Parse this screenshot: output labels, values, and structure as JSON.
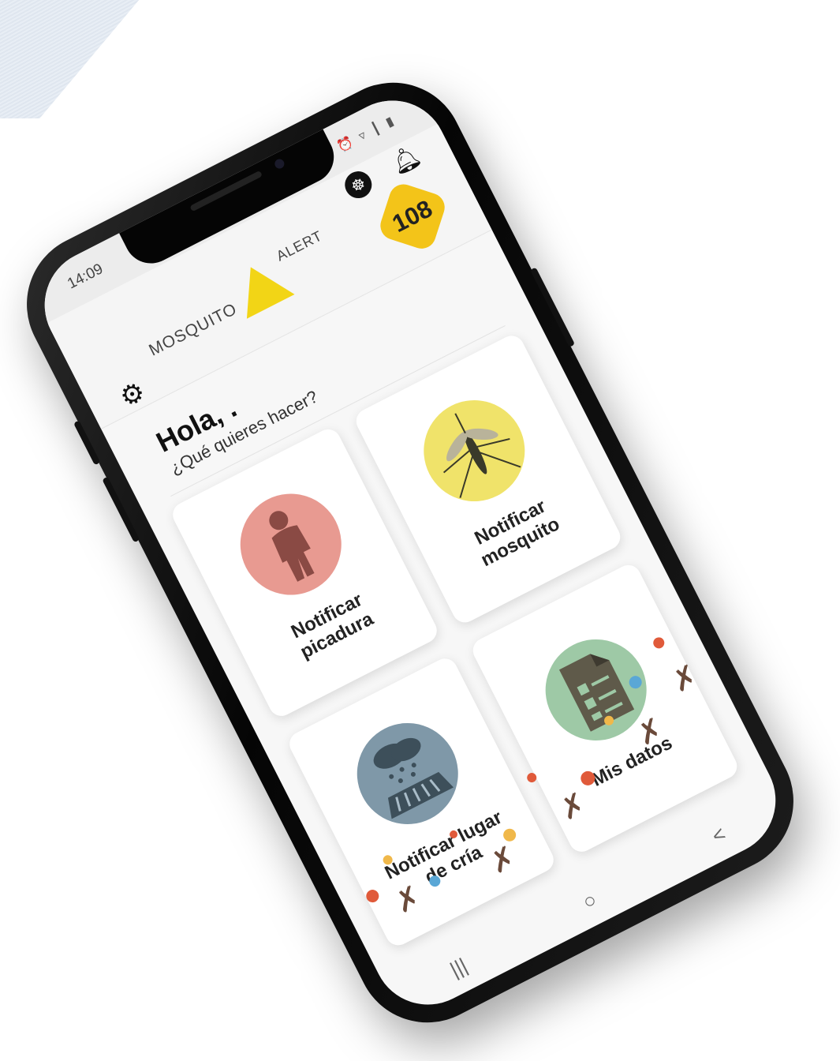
{
  "status_bar": {
    "time": "14:09",
    "icons": "⏰ ▿ ┃ ▮"
  },
  "header": {
    "logo_left": "MOSQUITO",
    "logo_right": "ALERT",
    "score": "108",
    "dna_icon": "dna-icon",
    "bell_icon": "bell-icon"
  },
  "greeting": {
    "hello": "Hola, .",
    "question": "¿Qué quieres hacer?"
  },
  "cards": [
    {
      "label": "Notificar picadura",
      "color": "#e89a91",
      "icon": "person-bite-icon"
    },
    {
      "label": "Notificar mosquito",
      "color": "#f0e36a",
      "icon": "mosquito-icon"
    },
    {
      "label": "Notificar lugar de cría",
      "color": "#7f98a8",
      "icon": "rain-drain-icon"
    },
    {
      "label": "Mis datos",
      "color": "#9ec9a6",
      "icon": "document-icon"
    }
  ],
  "nav": {
    "recents": "|||",
    "home": "○",
    "back": "<"
  },
  "colors": {
    "badge": "#f3c419",
    "logo": "#f2d516"
  }
}
